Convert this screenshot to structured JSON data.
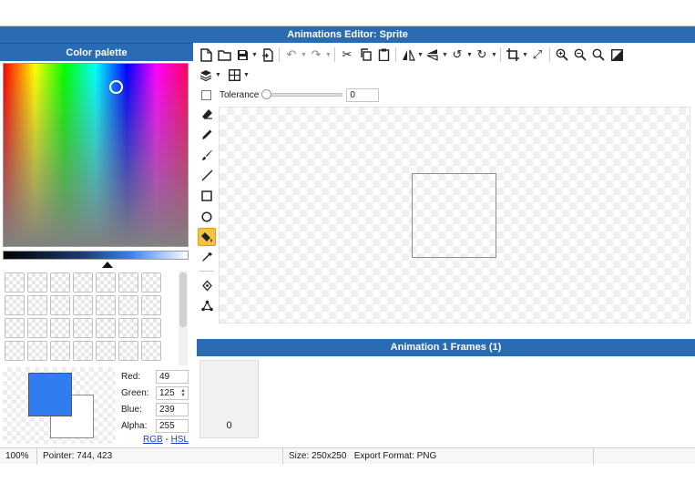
{
  "window": {
    "title": "Animations Editor: Sprite"
  },
  "palette": {
    "title": "Color palette",
    "primary_color": "#317def",
    "secondary_color": "#ffffff",
    "red_label": "Red:",
    "red_value": "49",
    "green_label": "Green:",
    "green_value": "125",
    "blue_label": "Blue:",
    "blue_value": "239",
    "alpha_label": "Alpha:",
    "alpha_value": "255",
    "rgb_link": "RGB",
    "link_separator": " - ",
    "hsl_link": "HSL"
  },
  "toolbar": {
    "row1": [
      "new-file-icon",
      "open-folder-icon",
      "save-icon",
      "export-icon",
      "undo-icon",
      "redo-icon",
      "cut-icon",
      "copy-icon",
      "paste-icon",
      "flip-horizontal-icon",
      "flip-vertical-icon",
      "rotate-left-icon",
      "rotate-right-icon",
      "crop-icon",
      "resize-icon",
      "zoom-in-icon",
      "zoom-out-icon",
      "zoom-reset-icon",
      "toggle-background-icon"
    ],
    "row2": [
      "layers-icon",
      "grid-icon"
    ]
  },
  "tolerance": {
    "label": "Tolerance",
    "value": "0"
  },
  "tools": [
    "eraser-icon",
    "pencil-icon",
    "brush-icon",
    "line-icon",
    "rectangle-icon",
    "ellipse-icon",
    "fill-bucket-icon",
    "eyedropper-icon",
    "anchor-point-icon",
    "nodes-icon"
  ],
  "active_tool": "fill-bucket-icon",
  "frames": {
    "title": "Animation 1 Frames (1)",
    "items": [
      {
        "number": "0"
      }
    ]
  },
  "status": {
    "zoom": "100%",
    "pointer": "Pointer: 744, 423",
    "size": "Size: 250x250",
    "export_format": "Export Format: PNG"
  }
}
